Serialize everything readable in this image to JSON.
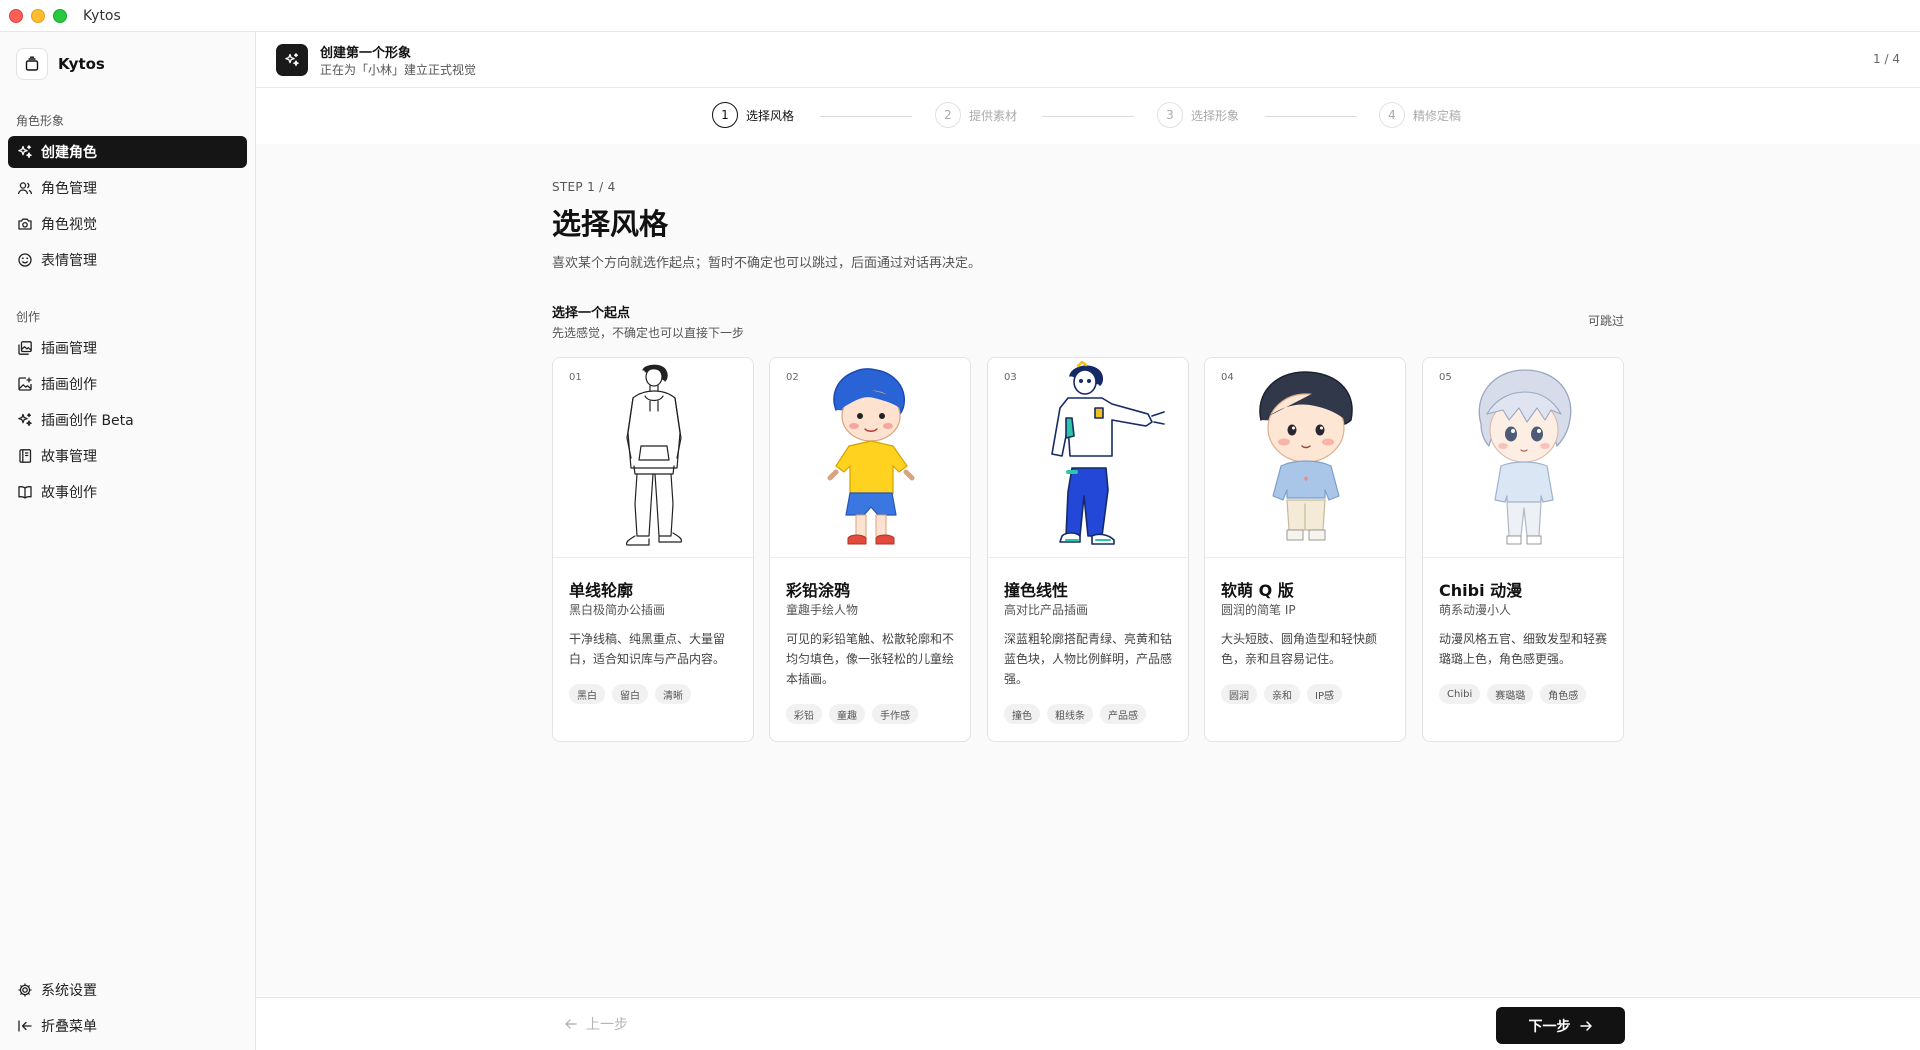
{
  "window": {
    "title": "Kytos"
  },
  "sidebar": {
    "brand": "Kytos",
    "groups": [
      {
        "label": "角色形象",
        "items": [
          {
            "label": "创建角色",
            "icon": "sparkles-icon",
            "active": true
          },
          {
            "label": "角色管理",
            "icon": "users-icon"
          },
          {
            "label": "角色视觉",
            "icon": "camera-icon"
          },
          {
            "label": "表情管理",
            "icon": "smile-icon"
          }
        ]
      },
      {
        "label": "创作",
        "items": [
          {
            "label": "插画管理",
            "icon": "images-icon"
          },
          {
            "label": "插画创作",
            "icon": "image-plus-icon"
          },
          {
            "label": "插画创作 Beta",
            "icon": "sparkles-icon"
          },
          {
            "label": "故事管理",
            "icon": "notebook-icon"
          },
          {
            "label": "故事创作",
            "icon": "book-open-icon"
          }
        ]
      }
    ],
    "bottom": [
      {
        "label": "系统设置",
        "icon": "gear-icon"
      },
      {
        "label": "折叠菜单",
        "icon": "collapse-icon"
      }
    ]
  },
  "header": {
    "title": "创建第一个形象",
    "subtitle": "正在为「小林」建立正式视觉",
    "page": "1 / 4"
  },
  "stepper": [
    {
      "num": "1",
      "label": "选择风格",
      "active": true
    },
    {
      "num": "2",
      "label": "提供素材"
    },
    {
      "num": "3",
      "label": "选择形象"
    },
    {
      "num": "4",
      "label": "精修定稿"
    }
  ],
  "main": {
    "step_tag": "STEP 1 / 4",
    "title": "选择风格",
    "description": "喜欢某个方向就选作起点；暂时不确定也可以跳过，后面通过对话再决定。",
    "section_title": "选择一个起点",
    "section_sub": "先选感觉，不确定也可以直接下一步",
    "skip": "可跳过",
    "styles": [
      {
        "num": "01",
        "name": "单线轮廓",
        "sub": "黑白极简办公插画",
        "desc": "干净线稿、纯黑重点、大量留白，适合知识库与产品内容。",
        "tags": [
          "黑白",
          "留白",
          "清晰"
        ]
      },
      {
        "num": "02",
        "name": "彩铅涂鸦",
        "sub": "童趣手绘人物",
        "desc": "可见的彩铅笔触、松散轮廓和不均匀填色，像一张轻松的儿童绘本插画。",
        "tags": [
          "彩铅",
          "童趣",
          "手作感"
        ]
      },
      {
        "num": "03",
        "name": "撞色线性",
        "sub": "高对比产品插画",
        "desc": "深蓝粗轮廓搭配青绿、亮黄和钴蓝色块，人物比例鲜明，产品感强。",
        "tags": [
          "撞色",
          "粗线条",
          "产品感"
        ]
      },
      {
        "num": "04",
        "name": "软萌 Q 版",
        "sub": "圆润的简笔 IP",
        "desc": "大头短肢、圆角造型和轻快颜色，亲和且容易记住。",
        "tags": [
          "圆润",
          "亲和",
          "IP感"
        ]
      },
      {
        "num": "05",
        "name": "Chibi 动漫",
        "sub": "萌系动漫小人",
        "desc": "动漫风格五官、细致发型和轻赛璐璐上色，角色感更强。",
        "tags": [
          "Chibi",
          "赛璐璐",
          "角色感"
        ]
      }
    ]
  },
  "footer": {
    "prev": "上一步",
    "next": "下一步"
  },
  "colors": {
    "accent": "#121212",
    "sidebar_bg": "#fafafa",
    "main_bg": "#fafafa"
  }
}
